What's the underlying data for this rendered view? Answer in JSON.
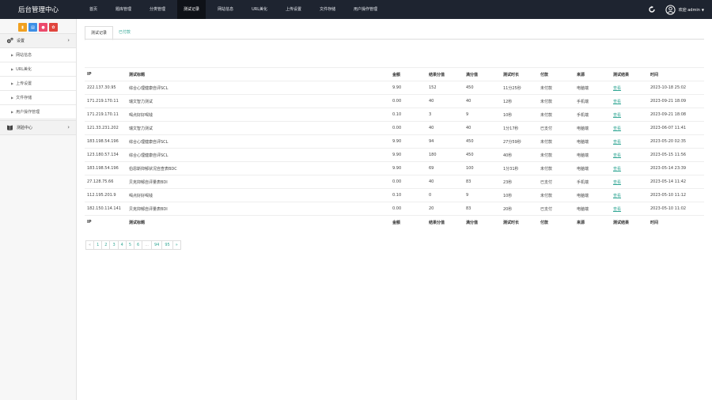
{
  "header": {
    "brand": "后台管理中心",
    "nav": [
      "首页",
      "题库管理",
      "分类管理",
      "测试记录",
      "网站信息",
      "URL美化",
      "上传设置",
      "文件存储",
      "用户操作管理"
    ],
    "active_nav": "测试记录",
    "welcome": "欢迎 admin"
  },
  "sidebar": {
    "groups": [
      {
        "label": "设置",
        "icon": "gears-icon"
      },
      {
        "label": "测验中心",
        "icon": "book-icon"
      }
    ],
    "items": [
      "网站信息",
      "URL美化",
      "上传设置",
      "文件存储",
      "用户操作管理"
    ]
  },
  "tabs": [
    "测试记录",
    "已付款"
  ],
  "table": {
    "columns": [
      "IP",
      "测试标题",
      "金额",
      "结果分值",
      "满分值",
      "测试时长",
      "付款",
      "来源",
      "测试结果",
      "时间"
    ],
    "rows": [
      [
        "222.137.30.95",
        "综合心理健康自评SCL",
        "9.90",
        "152",
        "450",
        "11分25秒",
        "未付款",
        "电脑端",
        "查看",
        "2023-10-18 25:02"
      ],
      [
        "171.219.170.11",
        "瑞文智力测试",
        "0.00",
        "40",
        "40",
        "12秒",
        "未付款",
        "手机端",
        "查看",
        "2023-09-21 18:09"
      ],
      [
        "171.219.170.11",
        "喝点好好喝钱",
        "0.10",
        "3",
        "9",
        "10秒",
        "未付款",
        "手机端",
        "查看",
        "2023-09-21 18:08"
      ],
      [
        "121.33.231.202",
        "瑞文智力测试",
        "0.00",
        "40",
        "40",
        "1分17秒",
        "已支付",
        "电脑端",
        "查看",
        "2023-06-07 11:41"
      ],
      [
        "183.198.54.196",
        "综合心理健康自评SCL",
        "9.90",
        "94",
        "450",
        "27分59秒",
        "未付款",
        "电脑端",
        "查看",
        "2023-05-20 02:35"
      ],
      [
        "123.180.57.134",
        "综合心理健康自评SCL",
        "9.90",
        "180",
        "450",
        "40秒",
        "未付款",
        "电脑端",
        "查看",
        "2023-05-15 11:56"
      ],
      [
        "183.198.54.196",
        "伯恩斯抑郁状况自查表BDC",
        "9.90",
        "69",
        "100",
        "1分31秒",
        "未付款",
        "电脑端",
        "查看",
        "2023-05-14 23:39"
      ],
      [
        "27.128.75.66",
        "贝克抑郁自评量表BDI",
        "0.00",
        "40",
        "83",
        "23秒",
        "已支付",
        "手机端",
        "查看",
        "2023-05-14 11:42"
      ],
      [
        "112.195.201.9",
        "喝点好好喝钱",
        "0.10",
        "0",
        "9",
        "10秒",
        "未付款",
        "电脑端",
        "查看",
        "2023-05-10 11:12"
      ],
      [
        "182.150.114.141",
        "贝克抑郁自评量表BDI",
        "0.00",
        "20",
        "83",
        "20秒",
        "已支付",
        "电脑端",
        "查看",
        "2023-05-10 11:02"
      ]
    ]
  },
  "pagination": [
    "«",
    "1",
    "2",
    "3",
    "4",
    "5",
    "6",
    "...",
    "94",
    "95",
    "»"
  ],
  "colors": {
    "topbar": "#1e2430",
    "accent": "#35a896"
  }
}
